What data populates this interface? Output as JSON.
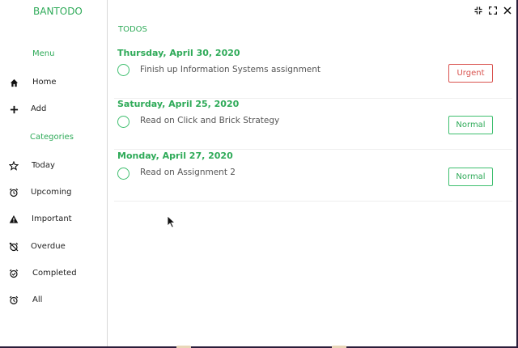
{
  "app": {
    "title": "BANTODO"
  },
  "sidebar": {
    "menu_title": "Menu",
    "menu_items": [
      {
        "label": "Home",
        "icon": "home-icon"
      },
      {
        "label": "Add",
        "icon": "plus-icon"
      }
    ],
    "categories_title": "Categories",
    "categories": [
      {
        "label": "Today",
        "icon": "star-icon"
      },
      {
        "label": "Upcoming",
        "icon": "alarm-clock-icon"
      },
      {
        "label": "Important",
        "icon": "warning-icon"
      },
      {
        "label": "Overdue",
        "icon": "alarm-off-icon"
      },
      {
        "label": "Completed",
        "icon": "alarm-check-icon"
      },
      {
        "label": "All",
        "icon": "alarm-icon"
      }
    ]
  },
  "main": {
    "title": "TODOS",
    "todos": [
      {
        "date": "Thursday, April 30, 2020",
        "text": "Finish up Information Systems assignment",
        "priority": "Urgent"
      },
      {
        "date": "Saturday, April 25, 2020",
        "text": "Read on Click and Brick Strategy",
        "priority": "Normal"
      },
      {
        "date": "Monday, April 27, 2020",
        "text": "Read on Assignment 2",
        "priority": "Normal"
      }
    ]
  },
  "colors": {
    "accent": "#2eaa58",
    "urgent": "#d9534f",
    "normal": "#3fbf6f"
  }
}
